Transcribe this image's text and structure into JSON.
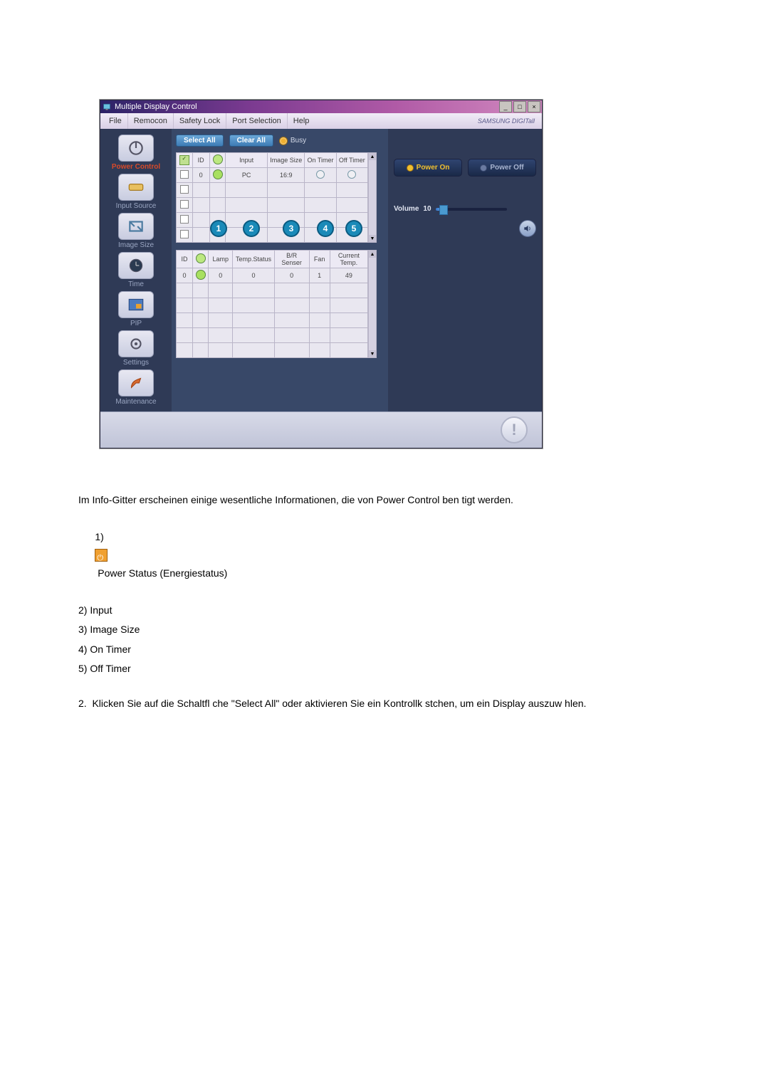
{
  "window": {
    "title": "Multiple Display Control",
    "menus": [
      "File",
      "Remocon",
      "Safety Lock",
      "Port Selection",
      "Help"
    ],
    "brand": "SAMSUNG DIGITall"
  },
  "sidebar": {
    "items": [
      {
        "label": "Power Control",
        "active": true
      },
      {
        "label": "Input Source"
      },
      {
        "label": "Image Size"
      },
      {
        "label": "Time"
      },
      {
        "label": "PIP"
      },
      {
        "label": "Settings"
      },
      {
        "label": "Maintenance"
      }
    ]
  },
  "center": {
    "select_all": "Select All",
    "clear_all": "Clear All",
    "busy": "Busy"
  },
  "grid1": {
    "headers": [
      "",
      "ID",
      "",
      "Input",
      "Image Size",
      "On Timer",
      "Off Timer"
    ],
    "rows": [
      {
        "checked": false,
        "id": "0",
        "pwr": true,
        "input": "PC",
        "imgsize": "16:9",
        "ontimer": "○",
        "offtimer": "○"
      },
      {
        "checked": false,
        "id": "",
        "pwr": false,
        "input": "",
        "imgsize": "",
        "ontimer": "",
        "offtimer": ""
      },
      {
        "checked": false,
        "id": "",
        "pwr": false,
        "input": "",
        "imgsize": "",
        "ontimer": "",
        "offtimer": ""
      },
      {
        "checked": false,
        "id": "",
        "pwr": false,
        "input": "",
        "imgsize": "",
        "ontimer": "",
        "offtimer": ""
      },
      {
        "checked": false,
        "id": "",
        "pwr": false,
        "input": "",
        "imgsize": "",
        "ontimer": "",
        "offtimer": ""
      }
    ]
  },
  "grid2": {
    "headers": [
      "ID",
      "",
      "Lamp",
      "Temp.Status",
      "B/R Senser",
      "Fan",
      "Current Temp."
    ],
    "rows": [
      {
        "id": "0",
        "pwr": true,
        "lamp": "0",
        "temp": "0",
        "br": "0",
        "fan": "1",
        "cur": "49"
      },
      {
        "id": "",
        "pwr": false,
        "lamp": "",
        "temp": "",
        "br": "",
        "fan": "",
        "cur": ""
      },
      {
        "id": "",
        "pwr": false,
        "lamp": "",
        "temp": "",
        "br": "",
        "fan": "",
        "cur": ""
      },
      {
        "id": "",
        "pwr": false,
        "lamp": "",
        "temp": "",
        "br": "",
        "fan": "",
        "cur": ""
      },
      {
        "id": "",
        "pwr": false,
        "lamp": "",
        "temp": "",
        "br": "",
        "fan": "",
        "cur": ""
      },
      {
        "id": "",
        "pwr": false,
        "lamp": "",
        "temp": "",
        "br": "",
        "fan": "",
        "cur": ""
      }
    ]
  },
  "callouts": [
    "1",
    "2",
    "3",
    "4",
    "5"
  ],
  "right": {
    "power_on": "Power On",
    "power_off": "Power Off",
    "volume_label": "Volume",
    "volume_value": "10",
    "volume_percent": 10
  },
  "doc": {
    "intro": "Im Info-Gitter erscheinen einige wesentliche Informationen, die von Power Control ben tigt werden.",
    "l1a": "1) ",
    "l1b": " Power Status (Energiestatus)",
    "l2": "2) Input",
    "l3": "3) Image Size",
    "l4": "4) On Timer",
    "l5": "5) Off Timer",
    "step2": "2.  Klicken Sie auf die Schaltfl che \"Select All\" oder aktivieren Sie ein Kontrollk stchen, um ein Display auszuw hlen."
  }
}
